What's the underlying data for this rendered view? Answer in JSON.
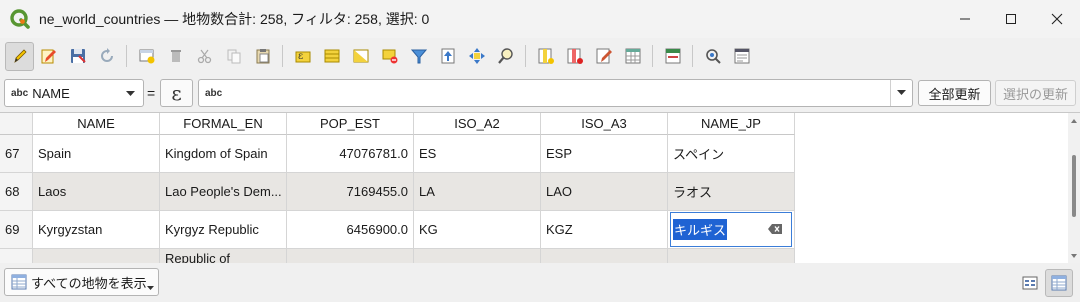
{
  "window": {
    "title": "ne_world_countries — 地物数合計: 258, フィルタ: 258, 選択: 0"
  },
  "toolbar": {
    "icons": [
      "toggle-editing-icon",
      "multi-edit-icon",
      "save-edits-icon",
      "reload-icon",
      "add-feature-icon",
      "delete-selected-icon",
      "cut-icon",
      "copy-icon",
      "paste-icon",
      "select-by-expression-icon",
      "select-all-icon",
      "invert-selection-icon",
      "deselect-all-icon",
      "filter-select-icon",
      "move-selection-to-top-icon",
      "pan-to-selected-icon",
      "zoom-to-selected-icon",
      "new-field-icon",
      "delete-field-icon",
      "field-calculator-icon",
      "conditional-formatting-icon",
      "dock-table-icon",
      "actions-icon",
      "form-view-icon"
    ]
  },
  "expression_bar": {
    "field_type": "abc",
    "field_name": "NAME",
    "equals": "=",
    "expression_symbol": "ε",
    "value_type": "abc",
    "update_all_label": "全部更新",
    "update_selected_label": "選択の更新"
  },
  "table": {
    "columns": [
      "NAME",
      "FORMAL_EN",
      "POP_EST",
      "ISO_A2",
      "ISO_A3",
      "NAME_JP"
    ],
    "rows": [
      {
        "num": "67",
        "cells": [
          "Spain",
          "Kingdom of Spain",
          "47076781.0",
          "ES",
          "ESP",
          "スペイン"
        ]
      },
      {
        "num": "68",
        "cells": [
          "Laos",
          "Lao People's Dem...",
          "7169455.0",
          "LA",
          "LAO",
          "ラオス"
        ]
      },
      {
        "num": "69",
        "cells": [
          "Kyrgyzstan",
          "Kyrgyz Republic",
          "6456900.0",
          "KG",
          "KGZ",
          "キルギス"
        ]
      },
      {
        "num": "",
        "cells": [
          "",
          "Republic of",
          "",
          "",
          "",
          ""
        ]
      }
    ],
    "editing_value": "キルギス"
  },
  "statusbar": {
    "filter_label": "すべての地物を表示"
  },
  "colors": {
    "accent": "#1f63d3",
    "qgis_green": "#589632",
    "qgis_yellow": "#ee7913"
  }
}
